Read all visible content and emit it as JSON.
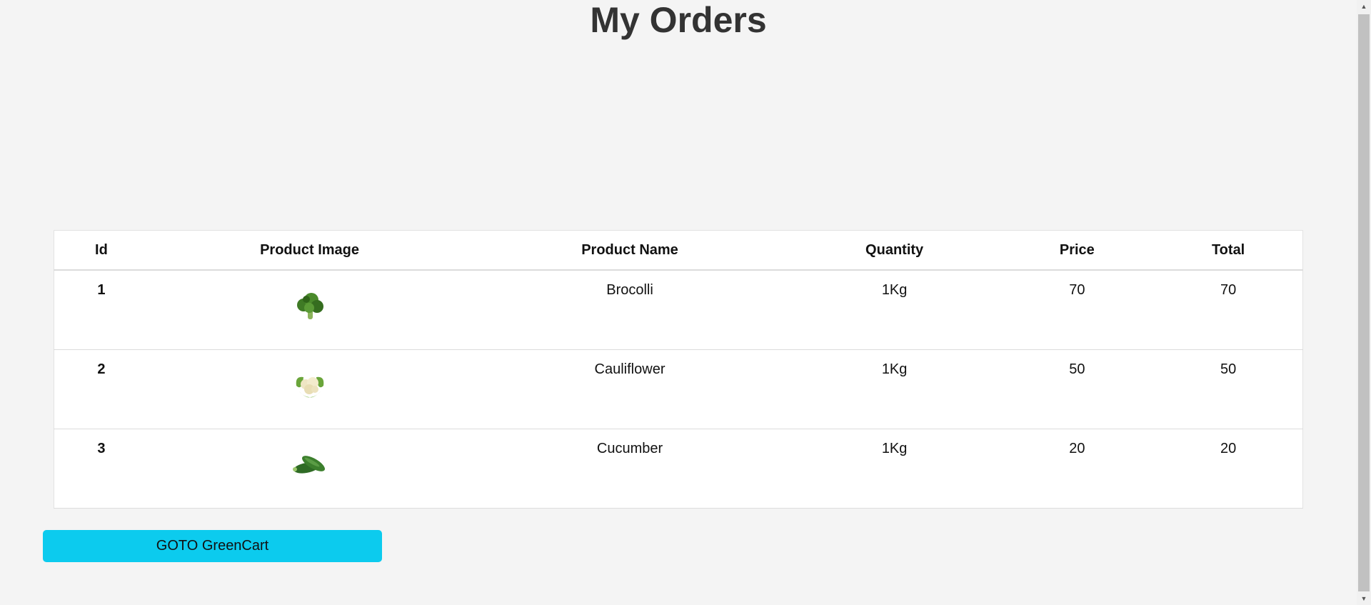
{
  "page": {
    "title": "My Orders"
  },
  "table": {
    "headers": {
      "id": "Id",
      "image": "Product Image",
      "name": "Product Name",
      "quantity": "Quantity",
      "price": "Price",
      "total": "Total"
    },
    "rows": [
      {
        "id": "1",
        "image_icon": "broccoli-icon",
        "name": "Brocolli",
        "quantity": "1Kg",
        "price": "70",
        "total": "70"
      },
      {
        "id": "2",
        "image_icon": "cauliflower-icon",
        "name": "Cauliflower",
        "quantity": "1Kg",
        "price": "50",
        "total": "50"
      },
      {
        "id": "3",
        "image_icon": "cucumber-icon",
        "name": "Cucumber",
        "quantity": "1Kg",
        "price": "20",
        "total": "20"
      }
    ]
  },
  "actions": {
    "goto_label": "GOTO GreenCart"
  },
  "colors": {
    "background": "#f4f4f4",
    "button": "#0ccbee",
    "table_background": "#ffffff"
  }
}
